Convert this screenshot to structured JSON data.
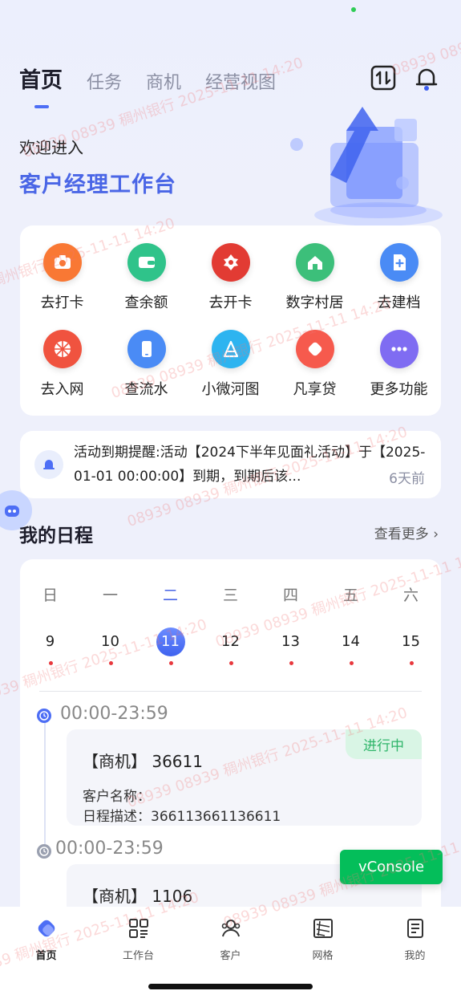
{
  "header": {
    "tabs": [
      {
        "label": "首页",
        "active": true
      },
      {
        "label": "任务",
        "active": false
      },
      {
        "label": "商机",
        "active": false
      },
      {
        "label": "经营视图",
        "active": false
      }
    ],
    "icons": [
      "switch-icon",
      "bell-icon"
    ]
  },
  "hero": {
    "welcome": "欢迎进入",
    "title": "客户经理工作台"
  },
  "quick": [
    {
      "label": "去打卡",
      "icon": "camera-icon",
      "color": "#f97834"
    },
    {
      "label": "查余额",
      "icon": "wallet-icon",
      "color": "#2fc38a"
    },
    {
      "label": "去开卡",
      "icon": "card-icon",
      "color": "#e23b33"
    },
    {
      "label": "数字村居",
      "icon": "village-icon",
      "color": "#3cbf7a"
    },
    {
      "label": "去建档",
      "icon": "add-file-icon",
      "color": "#4a8bf5"
    },
    {
      "label": "去入网",
      "icon": "network-icon",
      "color": "#f0533f"
    },
    {
      "label": "查流水",
      "icon": "phone-icon",
      "color": "#4a8bf5"
    },
    {
      "label": "小微河图",
      "icon": "map-icon",
      "color": "#2db4f0"
    },
    {
      "label": "凡享贷",
      "icon": "loan-icon",
      "color": "#f65a4d"
    },
    {
      "label": "更多功能",
      "icon": "more-icon",
      "color": "#7f6cf2"
    }
  ],
  "notice": {
    "text": "活动到期提醒:活动【2024下半年见面礼活动】于【2025-01-01 00:00:00】到期，到期后该...",
    "ago": "6天前"
  },
  "schedule": {
    "title": "我的日程",
    "more": "查看更多",
    "weekdays": [
      "日",
      "一",
      "二",
      "三",
      "四",
      "五",
      "六"
    ],
    "days": [
      "9",
      "10",
      "11",
      "12",
      "13",
      "14",
      "15"
    ],
    "selected_index": 2,
    "items": [
      {
        "time": "00:00-23:59",
        "title": "【商机】 36611",
        "status": "进行中",
        "customer_label": "客户名称：",
        "desc_label": "日程描述：",
        "desc": "366113661136611"
      },
      {
        "time": "00:00-23:59",
        "title": "【商机】 1106"
      }
    ]
  },
  "vconsole": "vConsole",
  "nav": [
    {
      "label": "首页",
      "icon": "home-icon",
      "active": true
    },
    {
      "label": "工作台",
      "icon": "workbench-icon",
      "active": false
    },
    {
      "label": "客户",
      "icon": "customer-icon",
      "active": false
    },
    {
      "label": "网格",
      "icon": "grid-map-icon",
      "active": false
    },
    {
      "label": "我的",
      "icon": "profile-icon",
      "active": false
    }
  ],
  "watermark": "08939 08939 稠州银行 2025-11-11 14:20"
}
